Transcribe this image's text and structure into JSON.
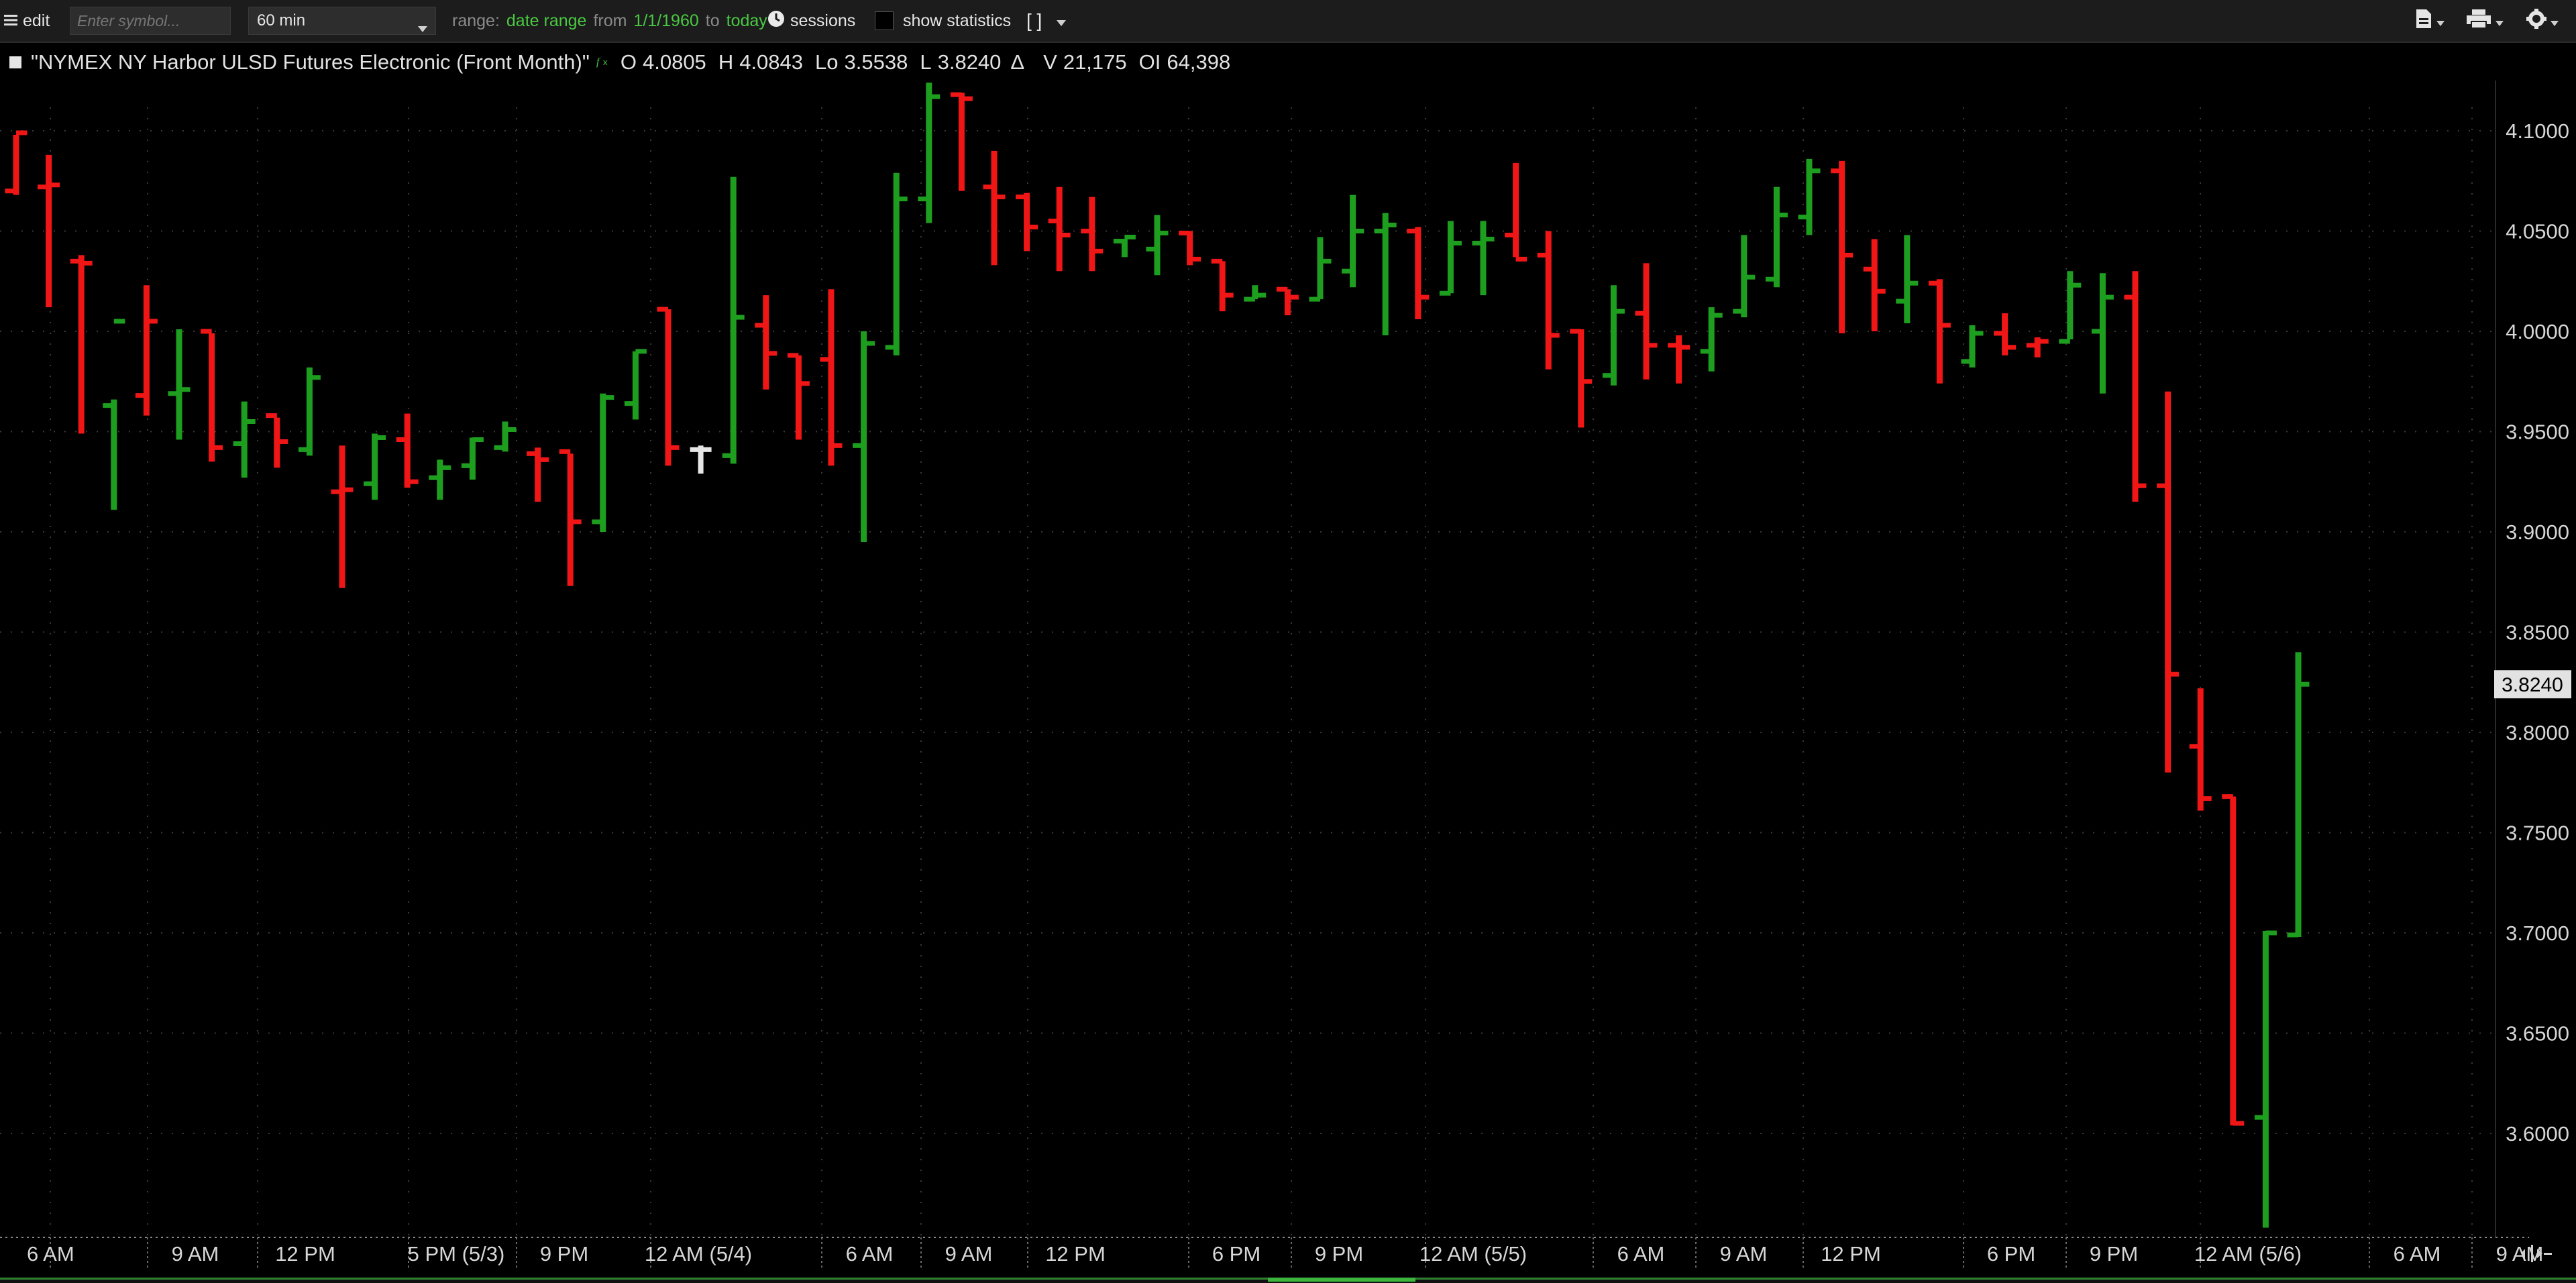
{
  "toolbar": {
    "menu_label": "edit",
    "symbol_placeholder": "Enter symbol...",
    "aggregation": "60 min",
    "range_label": "range:",
    "range_type": "date range",
    "from_label": "from",
    "from_date": "1/1/1960",
    "to_label": "to",
    "to_date": "today",
    "sessions_label": "sessions",
    "show_statistics_label": "show statistics",
    "brackets_label": "[ ]"
  },
  "header": {
    "symbol_description": "\"NYMEX NY Harbor ULSD Futures Electronic (Front Month)\"",
    "open_label": "O",
    "open": "4.0805",
    "high_label": "H",
    "high": "4.0843",
    "low_label": "Lo",
    "low": "3.5538",
    "last_label": "L",
    "last": "3.8240",
    "change_label": "Δ",
    "volume_label": "V",
    "volume": "21,175",
    "oi_label": "OI",
    "open_interest": "64,398"
  },
  "price_axis": {
    "labels": [
      "4.1000",
      "4.0500",
      "4.0000",
      "3.9500",
      "3.9000",
      "3.8500",
      "3.8000",
      "3.7500",
      "3.7000",
      "3.6500",
      "3.6000"
    ],
    "current_price_label": "3.8240"
  },
  "time_axis": {
    "labels": [
      "6 AM",
      "9 AM",
      "12 PM",
      "5 PM (5/3)",
      "9 PM",
      "12 AM (5/4)",
      "6 AM",
      "9 AM",
      "12 PM",
      "6 PM",
      "9 PM",
      "12 AM (5/5)",
      "6 AM",
      "9 AM",
      "12 PM",
      "6 PM",
      "9 PM",
      "12 AM (5/6)",
      "6 AM",
      "9 AM"
    ]
  },
  "colors": {
    "up": "#1e9e1e",
    "down": "#f01616",
    "current_bar": "#e6e6e6",
    "background": "#000000",
    "grid": "#3a3a3a",
    "price_box": "#e2e2e2"
  },
  "chart_data": {
    "type": "ohlc",
    "y_range": [
      3.535,
      4.125
    ],
    "grid": true,
    "bars": [
      {
        "o": 4.07,
        "h": 4.098,
        "l": 4.068,
        "c": 4.099,
        "dir": "down"
      },
      {
        "o": 4.072,
        "h": 4.088,
        "l": 4.012,
        "c": 4.073,
        "dir": "down"
      },
      {
        "o": 4.035,
        "h": 4.038,
        "l": 3.949,
        "c": 4.034,
        "dir": "down"
      },
      {
        "o": 3.963,
        "h": 3.966,
        "l": 3.911,
        "c": 4.005,
        "dir": "up"
      },
      {
        "o": 3.968,
        "h": 4.023,
        "l": 3.958,
        "c": 4.005,
        "dir": "down"
      },
      {
        "o": 3.969,
        "h": 4.001,
        "l": 3.946,
        "c": 3.971,
        "dir": "up"
      },
      {
        "o": 4.0,
        "h": 3.999,
        "l": 3.935,
        "c": 3.942,
        "dir": "down"
      },
      {
        "o": 3.944,
        "h": 3.965,
        "l": 3.927,
        "c": 3.955,
        "dir": "up"
      },
      {
        "o": 3.958,
        "h": 3.957,
        "l": 3.932,
        "c": 3.945,
        "dir": "down"
      },
      {
        "o": 3.941,
        "h": 3.982,
        "l": 3.938,
        "c": 3.977,
        "dir": "up"
      },
      {
        "o": 3.92,
        "h": 3.943,
        "l": 3.872,
        "c": 3.921,
        "dir": "down"
      },
      {
        "o": 3.924,
        "h": 3.949,
        "l": 3.916,
        "c": 3.947,
        "dir": "up"
      },
      {
        "o": 3.946,
        "h": 3.959,
        "l": 3.922,
        "c": 3.925,
        "dir": "down"
      },
      {
        "o": 3.927,
        "h": 3.936,
        "l": 3.916,
        "c": 3.932,
        "dir": "up"
      },
      {
        "o": 3.933,
        "h": 3.947,
        "l": 3.926,
        "c": 3.946,
        "dir": "up"
      },
      {
        "o": 3.942,
        "h": 3.955,
        "l": 3.94,
        "c": 3.951,
        "dir": "up"
      },
      {
        "o": 3.939,
        "h": 3.942,
        "l": 3.915,
        "c": 3.936,
        "dir": "down"
      },
      {
        "o": 3.94,
        "h": 3.939,
        "l": 3.873,
        "c": 3.905,
        "dir": "down"
      },
      {
        "o": 3.905,
        "h": 3.969,
        "l": 3.9,
        "c": 3.967,
        "dir": "up"
      },
      {
        "o": 3.964,
        "h": 3.99,
        "l": 3.956,
        "c": 3.99,
        "dir": "up"
      },
      {
        "o": 4.011,
        "h": 4.011,
        "l": 3.933,
        "c": 3.942,
        "dir": "down"
      },
      {
        "o": 3.941,
        "h": 3.943,
        "l": 3.929,
        "c": 3.941,
        "dir": "current"
      },
      {
        "o": 3.938,
        "h": 4.077,
        "l": 3.934,
        "c": 4.007,
        "dir": "up"
      },
      {
        "o": 4.003,
        "h": 4.018,
        "l": 3.971,
        "c": 3.989,
        "dir": "down"
      },
      {
        "o": 3.988,
        "h": 3.988,
        "l": 3.946,
        "c": 3.974,
        "dir": "down"
      },
      {
        "o": 3.986,
        "h": 4.021,
        "l": 3.933,
        "c": 3.943,
        "dir": "down"
      },
      {
        "o": 3.943,
        "h": 4.0,
        "l": 3.895,
        "c": 3.994,
        "dir": "up"
      },
      {
        "o": 3.992,
        "h": 4.079,
        "l": 3.988,
        "c": 4.066,
        "dir": "up"
      },
      {
        "o": 4.066,
        "h": 4.124,
        "l": 4.054,
        "c": 4.117,
        "dir": "up"
      },
      {
        "o": 4.118,
        "h": 4.119,
        "l": 4.07,
        "c": 4.116,
        "dir": "down"
      },
      {
        "o": 4.072,
        "h": 4.09,
        "l": 4.033,
        "c": 4.067,
        "dir": "down"
      },
      {
        "o": 4.067,
        "h": 4.069,
        "l": 4.04,
        "c": 4.052,
        "dir": "down"
      },
      {
        "o": 4.055,
        "h": 4.072,
        "l": 4.03,
        "c": 4.048,
        "dir": "down"
      },
      {
        "o": 4.05,
        "h": 4.067,
        "l": 4.03,
        "c": 4.04,
        "dir": "down"
      },
      {
        "o": 4.045,
        "h": 4.046,
        "l": 4.037,
        "c": 4.047,
        "dir": "up"
      },
      {
        "o": 4.041,
        "h": 4.058,
        "l": 4.028,
        "c": 4.049,
        "dir": "up"
      },
      {
        "o": 4.049,
        "h": 4.05,
        "l": 4.033,
        "c": 4.036,
        "dir": "down"
      },
      {
        "o": 4.035,
        "h": 4.035,
        "l": 4.01,
        "c": 4.018,
        "dir": "down"
      },
      {
        "o": 4.016,
        "h": 4.023,
        "l": 4.016,
        "c": 4.018,
        "dir": "up"
      },
      {
        "o": 4.021,
        "h": 4.021,
        "l": 4.008,
        "c": 4.017,
        "dir": "down"
      },
      {
        "o": 4.016,
        "h": 4.047,
        "l": 4.016,
        "c": 4.035,
        "dir": "up"
      },
      {
        "o": 4.03,
        "h": 4.068,
        "l": 4.022,
        "c": 4.05,
        "dir": "up"
      },
      {
        "o": 4.05,
        "h": 4.059,
        "l": 3.998,
        "c": 4.053,
        "dir": "up"
      },
      {
        "o": 4.05,
        "h": 4.052,
        "l": 4.006,
        "c": 4.017,
        "dir": "down"
      },
      {
        "o": 4.019,
        "h": 4.055,
        "l": 4.019,
        "c": 4.044,
        "dir": "up"
      },
      {
        "o": 4.044,
        "h": 4.055,
        "l": 4.018,
        "c": 4.046,
        "dir": "up"
      },
      {
        "o": 4.048,
        "h": 4.084,
        "l": 4.037,
        "c": 4.036,
        "dir": "down"
      },
      {
        "o": 4.038,
        "h": 4.05,
        "l": 3.981,
        "c": 3.998,
        "dir": "down"
      },
      {
        "o": 4.0,
        "h": 4.001,
        "l": 3.952,
        "c": 3.975,
        "dir": "down"
      },
      {
        "o": 3.978,
        "h": 4.023,
        "l": 3.973,
        "c": 4.01,
        "dir": "up"
      },
      {
        "o": 4.009,
        "h": 4.034,
        "l": 3.976,
        "c": 3.993,
        "dir": "down"
      },
      {
        "o": 3.993,
        "h": 3.998,
        "l": 3.974,
        "c": 3.992,
        "dir": "down"
      },
      {
        "o": 3.99,
        "h": 4.012,
        "l": 3.98,
        "c": 4.008,
        "dir": "up"
      },
      {
        "o": 4.01,
        "h": 4.048,
        "l": 4.007,
        "c": 4.027,
        "dir": "up"
      },
      {
        "o": 4.026,
        "h": 4.072,
        "l": 4.022,
        "c": 4.058,
        "dir": "up"
      },
      {
        "o": 4.057,
        "h": 4.086,
        "l": 4.048,
        "c": 4.08,
        "dir": "up"
      },
      {
        "o": 4.08,
        "h": 4.085,
        "l": 3.999,
        "c": 4.038,
        "dir": "down"
      },
      {
        "o": 4.031,
        "h": 4.046,
        "l": 4.0,
        "c": 4.02,
        "dir": "down"
      },
      {
        "o": 4.015,
        "h": 4.048,
        "l": 4.004,
        "c": 4.024,
        "dir": "up"
      },
      {
        "o": 4.024,
        "h": 4.026,
        "l": 3.974,
        "c": 4.003,
        "dir": "down"
      },
      {
        "o": 3.985,
        "h": 4.003,
        "l": 3.982,
        "c": 3.999,
        "dir": "up"
      },
      {
        "o": 3.999,
        "h": 4.009,
        "l": 3.988,
        "c": 3.992,
        "dir": "down"
      },
      {
        "o": 3.993,
        "h": 3.997,
        "l": 3.987,
        "c": 3.995,
        "dir": "down"
      },
      {
        "o": 3.995,
        "h": 4.03,
        "l": 3.996,
        "c": 4.023,
        "dir": "up"
      },
      {
        "o": 4.0,
        "h": 4.029,
        "l": 3.969,
        "c": 4.017,
        "dir": "up"
      },
      {
        "o": 4.017,
        "h": 4.03,
        "l": 3.915,
        "c": 3.923,
        "dir": "down"
      },
      {
        "o": 3.923,
        "h": 3.97,
        "l": 3.78,
        "c": 3.829,
        "dir": "down"
      },
      {
        "o": 3.793,
        "h": 3.822,
        "l": 3.761,
        "c": 3.767,
        "dir": "down"
      },
      {
        "o": 3.768,
        "h": 3.768,
        "l": 3.604,
        "c": 3.605,
        "dir": "down"
      },
      {
        "o": 3.608,
        "h": 3.701,
        "l": 3.553,
        "c": 3.7,
        "dir": "up"
      },
      {
        "o": 3.699,
        "h": 3.84,
        "l": 3.698,
        "c": 3.824,
        "dir": "up"
      }
    ]
  }
}
